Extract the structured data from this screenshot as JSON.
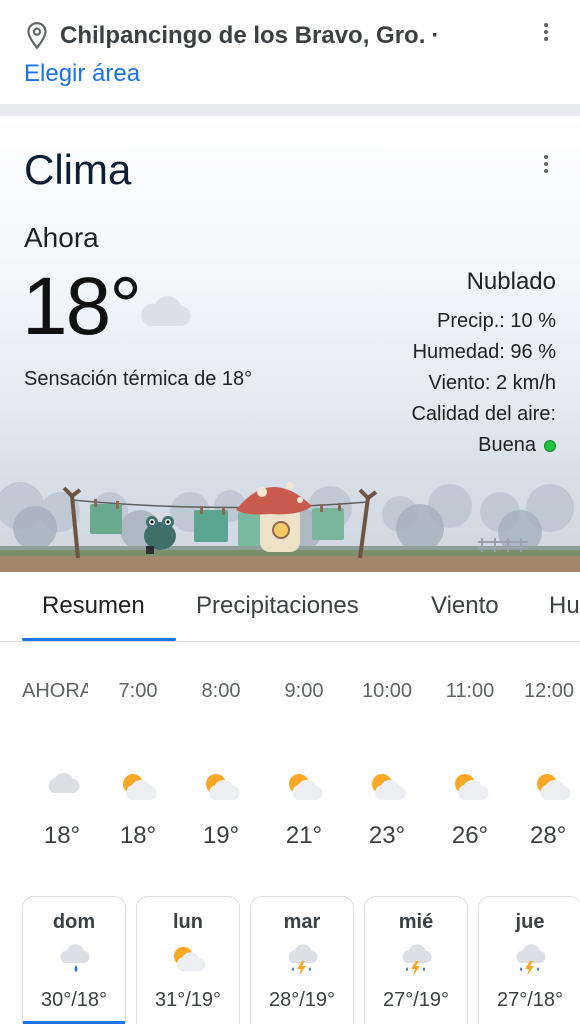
{
  "location": {
    "name": "Chilpancingo de los Bravo, Gro.",
    "separator": "·",
    "change_area_label": "Elegir área"
  },
  "weather": {
    "title": "Clima",
    "now_label": "Ahora",
    "temperature": "18°",
    "feels_like": "Sensación térmica de 18°",
    "condition": "Nublado",
    "precip": "Precip.: 10 %",
    "humidity": "Humedad: 96 %",
    "wind": "Viento: 2 km/h",
    "air_quality_label": "Calidad del aire:",
    "air_quality_value": "Buena",
    "air_quality_color": "#1ec23e"
  },
  "tabs": [
    {
      "label": "Resumen",
      "active": true
    },
    {
      "label": "Precipitaciones",
      "active": false
    },
    {
      "label": "Viento",
      "active": false
    },
    {
      "label": "Hu",
      "active": false
    }
  ],
  "hourly": [
    {
      "time": "AHORA",
      "icon": "cloud-icon",
      "temp": "18°"
    },
    {
      "time": "7:00",
      "icon": "partly-cloudy-icon",
      "temp": "18°"
    },
    {
      "time": "8:00",
      "icon": "partly-cloudy-icon",
      "temp": "19°"
    },
    {
      "time": "9:00",
      "icon": "partly-cloudy-icon",
      "temp": "21°"
    },
    {
      "time": "10:00",
      "icon": "partly-cloudy-icon",
      "temp": "23°"
    },
    {
      "time": "11:00",
      "icon": "partly-cloudy-icon",
      "temp": "26°"
    },
    {
      "time": "12:00",
      "icon": "partly-cloudy-icon",
      "temp": "28°"
    }
  ],
  "daily": [
    {
      "day": "dom",
      "icon": "rain-cloud-icon",
      "range": "30°/18°",
      "active": true
    },
    {
      "day": "lun",
      "icon": "partly-cloudy-icon",
      "range": "31°/19°",
      "active": false
    },
    {
      "day": "mar",
      "icon": "thunderstorm-icon",
      "range": "28°/19°",
      "active": false
    },
    {
      "day": "mié",
      "icon": "thunderstorm-icon",
      "range": "27°/19°",
      "active": false
    },
    {
      "day": "jue",
      "icon": "thunderstorm-icon",
      "range": "27°/18°",
      "active": false
    }
  ],
  "colors": {
    "accent": "#1a73e8",
    "sun": "#f9a825",
    "cloud": "#dcdfe4"
  }
}
